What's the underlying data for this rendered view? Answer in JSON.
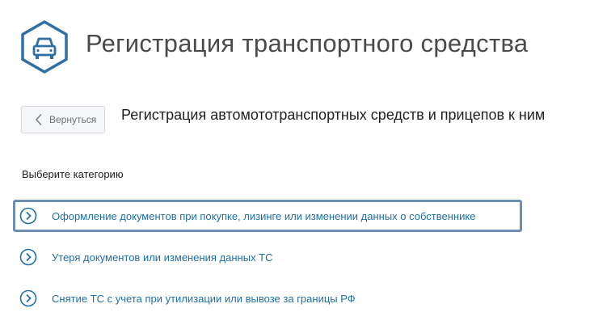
{
  "header": {
    "title": "Регистрация транспортного средства",
    "icon": "car-icon",
    "accent": "#2f6fa4"
  },
  "back_button": {
    "label": "Вернуться",
    "icon": "chevron-left-icon"
  },
  "section": {
    "title": "Регистрация автомототранспортных средств и прицепов к ним"
  },
  "category_prompt": "Выберите категорию",
  "options": [
    {
      "label": "Оформление документов при покупке, лизинге или изменении данных о собственнике",
      "icon": "chevron-circle-right-icon",
      "highlighted": true
    },
    {
      "label": "Утеря документов или изменения данных ТС",
      "icon": "chevron-circle-right-icon",
      "highlighted": false
    },
    {
      "label": "Снятие ТС с учета при утилизации или вывозе за границы РФ",
      "icon": "chevron-circle-right-icon",
      "highlighted": false
    }
  ],
  "colors": {
    "link": "#1f6fa9",
    "highlight_border": "#6c8fb3"
  }
}
